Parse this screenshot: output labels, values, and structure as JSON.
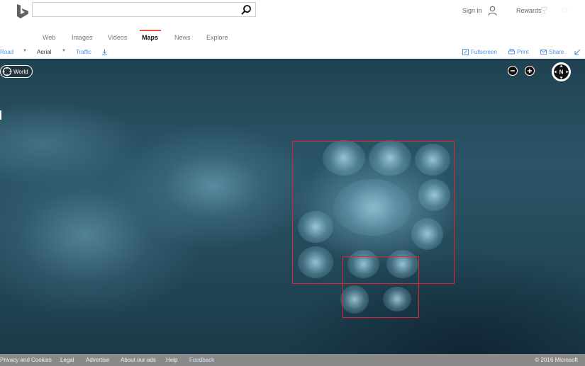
{
  "header": {
    "search": {
      "value": "",
      "placeholder": ""
    },
    "sign_in_label": "Sign in",
    "rewards_label": "Rewards"
  },
  "scopes": [
    {
      "label": "Web",
      "active": false
    },
    {
      "label": "Images",
      "active": false
    },
    {
      "label": "Videos",
      "active": false
    },
    {
      "label": "Maps",
      "active": true
    },
    {
      "label": "News",
      "active": false
    },
    {
      "label": "Explore",
      "active": false
    }
  ],
  "toolbar": {
    "road": "Road",
    "aerial": "Aerial",
    "traffic": "Traffic",
    "fullscreen": "Fullscreen",
    "print": "Print",
    "share": "Share"
  },
  "map": {
    "world_label": "World",
    "compass_label": "N",
    "annotation_color": "#e0262a"
  },
  "footer": {
    "links": [
      "Privacy and Cookies",
      "Legal",
      "Advertise",
      "About our ads",
      "Help",
      "Feedback"
    ],
    "copyright": "© 2016 Microsoft"
  },
  "colors": {
    "accent": "#e9533d",
    "link_blue": "#4a90d9",
    "footer_bg": "#8a8a8a"
  }
}
